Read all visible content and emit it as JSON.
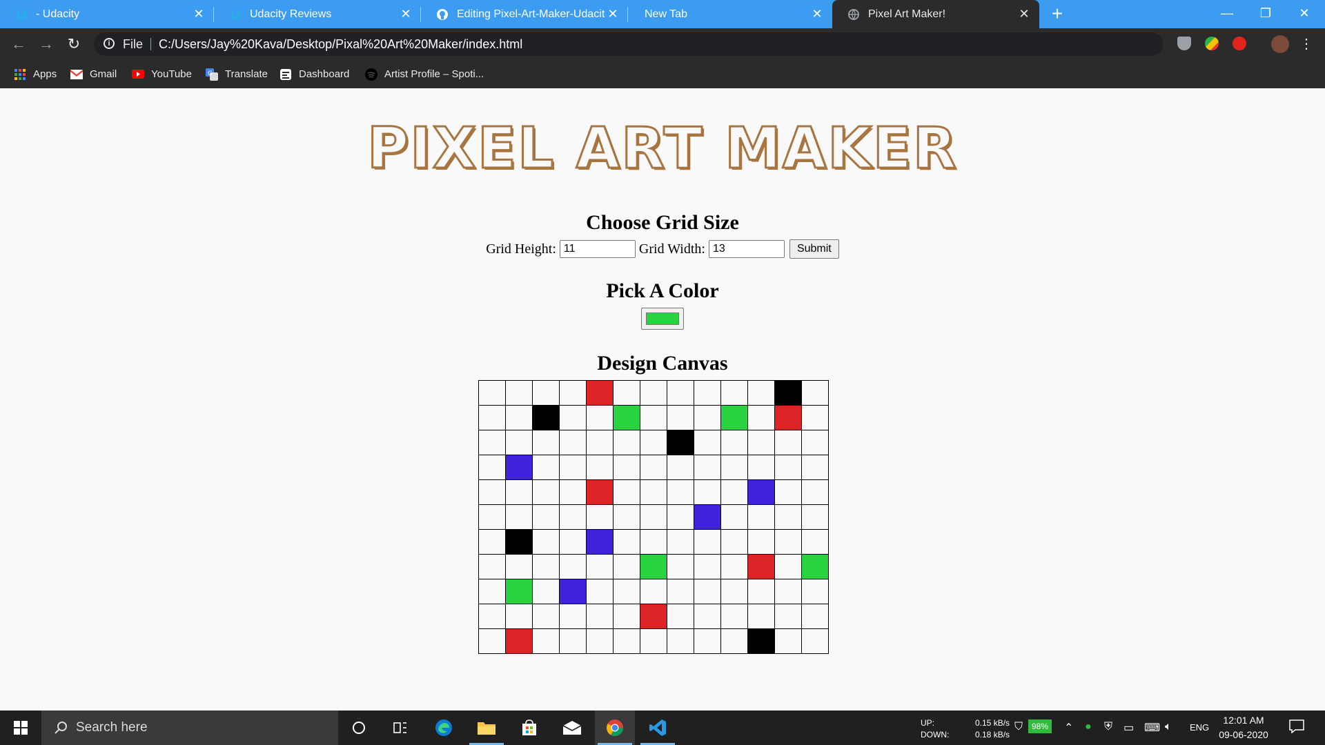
{
  "browser": {
    "tabs": [
      {
        "title": "- Udacity",
        "favicon": "udacity-icon",
        "active": false
      },
      {
        "title": "Udacity Reviews",
        "favicon": "udacity-icon",
        "active": false
      },
      {
        "title": "Editing Pixel-Art-Maker-Udacity-",
        "favicon": "github-icon",
        "active": false
      },
      {
        "title": "New Tab",
        "favicon": "",
        "active": false
      },
      {
        "title": "Pixel Art Maker!",
        "favicon": "globe-icon",
        "active": true
      }
    ],
    "new_tab_label": "+",
    "window_controls": {
      "minimize": "—",
      "restore": "❐",
      "close": "✕"
    },
    "address": {
      "scheme_label": "File",
      "url": "C:/Users/Jay%20Kava/Desktop/Pixal%20Art%20Maker/index.html"
    },
    "bookmarks": [
      {
        "label": "Apps",
        "icon": "apps-grid-icon"
      },
      {
        "label": "Gmail",
        "icon": "gmail-icon"
      },
      {
        "label": "YouTube",
        "icon": "youtube-icon"
      },
      {
        "label": "Translate",
        "icon": "translate-icon"
      },
      {
        "label": "Dashboard",
        "icon": "dashboard-icon"
      },
      {
        "label": "Artist Profile – Spoti...",
        "icon": "spotify-icon"
      }
    ]
  },
  "page": {
    "logo": "Pixel Art Maker",
    "grid_heading": "Choose Grid Size",
    "height_label": "Grid Height:",
    "height_value": "11",
    "width_label": "Grid Width:",
    "width_value": "13",
    "submit_label": "Submit",
    "color_heading": "Pick A Color",
    "selected_color": "#28d33f",
    "canvas_heading": "Design Canvas",
    "canvas": {
      "rows": 11,
      "cols": 13,
      "palette": {
        "R": "#dd2325",
        "G": "#28d33f",
        "B": "#4121d9",
        "K": "#000000"
      },
      "painted": [
        [
          0,
          4,
          "R"
        ],
        [
          0,
          11,
          "K"
        ],
        [
          1,
          2,
          "K"
        ],
        [
          1,
          5,
          "G"
        ],
        [
          1,
          9,
          "G"
        ],
        [
          1,
          11,
          "R"
        ],
        [
          2,
          7,
          "K"
        ],
        [
          3,
          1,
          "B"
        ],
        [
          4,
          4,
          "R"
        ],
        [
          4,
          10,
          "B"
        ],
        [
          5,
          8,
          "B"
        ],
        [
          6,
          1,
          "K"
        ],
        [
          6,
          4,
          "B"
        ],
        [
          7,
          6,
          "G"
        ],
        [
          7,
          10,
          "R"
        ],
        [
          7,
          12,
          "G"
        ],
        [
          8,
          1,
          "G"
        ],
        [
          8,
          3,
          "B"
        ],
        [
          9,
          6,
          "R"
        ],
        [
          10,
          1,
          "R"
        ],
        [
          10,
          10,
          "K"
        ]
      ]
    }
  },
  "taskbar": {
    "search_placeholder": "Search here",
    "net_up_label": "UP:",
    "net_up_value": "0.15 kB/s",
    "net_down_label": "DOWN:",
    "net_down_value": "0.18 kB/s",
    "battery": "98%",
    "language": "ENG",
    "time": "12:01 AM",
    "date": "09-06-2020"
  }
}
